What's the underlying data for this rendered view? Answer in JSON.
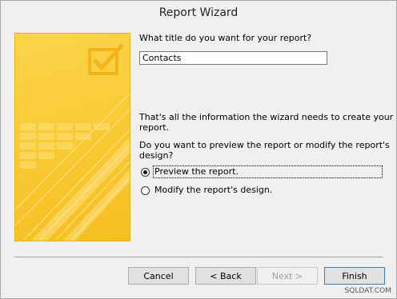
{
  "window": {
    "title": "Report Wizard"
  },
  "wizard": {
    "title_prompt": "What title do you want for your report?",
    "title_value": "Contacts",
    "info_line1": "That's all the information the wizard needs to create your",
    "info_line2": "report.",
    "question_line1": "Do you want to preview the report or modify the report's",
    "question_line2": "design?",
    "options": [
      {
        "label": "Preview the report.",
        "selected": true
      },
      {
        "label": "Modify the report's design.",
        "selected": false
      }
    ]
  },
  "buttons": {
    "cancel": "Cancel",
    "back": "< Back",
    "next": "Next >",
    "finish": "Finish"
  },
  "art": {
    "icon": "checkbox-check-icon",
    "accent": "#f9c932"
  },
  "watermark": "SQLDAT.COM"
}
